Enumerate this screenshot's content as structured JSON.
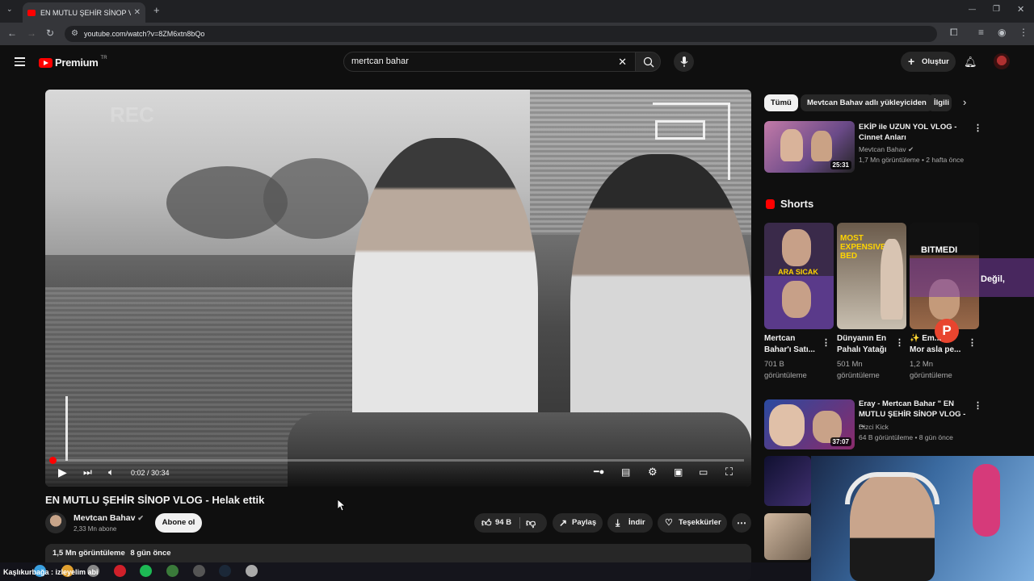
{
  "browser": {
    "tab_title": "EN MUTLU ŞEHİR SİNOP VLOG",
    "tab_close": "✕",
    "new_tab": "+",
    "url": "youtube.com/watch?v=8ZM6xtn8bQo",
    "window": {
      "minimize": "—",
      "restore": "❐",
      "close": "✕"
    }
  },
  "header": {
    "logo_text": "Premium",
    "region": "TR",
    "search_value": "mertcan bahar",
    "create_label": "Oluştur"
  },
  "player": {
    "time": "0:02 / 30:34",
    "overlay_rec": "REC",
    "progress_fraction": 0.001
  },
  "video": {
    "title": "EN MUTLU ŞEHİR SİNOP VLOG - Helak ettik",
    "channel": "Mevtcan Bahav",
    "subscribers": "2,33 Mn abone",
    "subscribe_label": "Abone ol",
    "likes": "94 B",
    "share_label": "Paylaş",
    "download_label": "İndir",
    "thanks_label": "Teşekkürler",
    "views": "1,5 Mn görüntüleme",
    "age": "8 gün önce"
  },
  "chips": [
    "Tümü",
    "Mevtcan Bahav adlı yükleyiciden",
    "İlgili"
  ],
  "recommended": [
    {
      "title_line1": "EKİP ile UZUN YOL VLOG -",
      "title_line2": "Cinnet Anları",
      "channel": "Mevtcan Bahav",
      "meta": "1,7 Mn görüntüleme • 2 hafta önce",
      "duration": "25:31"
    },
    {
      "title_line1": "Eray - Mertcan Bahar \" EN",
      "title_line2": "MUTLU ŞEHİR SİNOP VLOG - ...",
      "channel": "Dizci Kick",
      "meta": "64 B görüntüleme • 8 gün önce",
      "duration": "37:07"
    }
  ],
  "shorts": {
    "heading": "Shorts",
    "items": [
      {
        "title_line1": "Mertcan",
        "title_line2": "Bahar'ı Satı...",
        "views_line1": "701 B",
        "views_line2": "görüntüleme",
        "thumb_text": "ARA SICAK"
      },
      {
        "title_line1": "Dünyanın En",
        "title_line2": "Pahalı Yatağı",
        "views_line1": "501 Mn",
        "views_line2": "görüntüleme",
        "thumb_text": "MOST EXPENSIVE BED"
      },
      {
        "title_line1": "✨ Em...",
        "title_line2": "Mor asla pe...",
        "views_line1": "1,2 Mn",
        "views_line2": "görüntüleme",
        "thumb_text": "BITMEDI"
      }
    ]
  },
  "stream_overlay": {
    "caption": "Değil,",
    "badge": "P"
  },
  "taskbar": {
    "text": "Kaşlıkurbağa : izleyelim abi"
  },
  "colors": {
    "accent": "#ff0000",
    "background": "#0f0f0f",
    "chip": "#272727"
  }
}
